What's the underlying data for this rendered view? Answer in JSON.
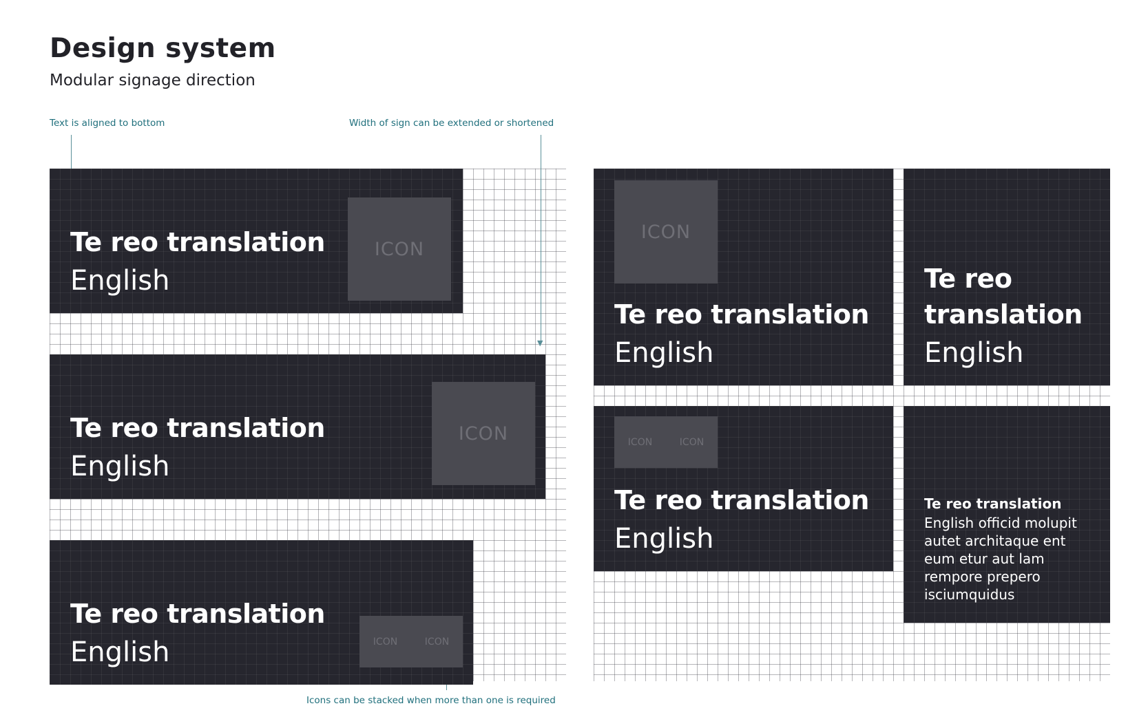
{
  "header": {
    "title": "Design system",
    "subtitle": "Modular signage direction"
  },
  "annotations": {
    "text_aligned": "Text is aligned to bottom",
    "width_extend": "Width of sign can be extended or shortened",
    "icons_stacked": "Icons can be stacked when more than one is required"
  },
  "signs": {
    "te_reo": "Te reo translation",
    "te_reo_line1": "Te reo",
    "te_reo_line2": "translation",
    "english": "English",
    "icon_label": "ICON",
    "paragraph_title": "Te reo translation",
    "paragraph_body": "English officid molupit autet architaque ent eum etur aut lam rempore prepero isciumquidus"
  },
  "colors": {
    "sign_background": "#26262e",
    "icon_placeholder": "#4a4a51",
    "annotation_text": "#1f6f7c"
  }
}
